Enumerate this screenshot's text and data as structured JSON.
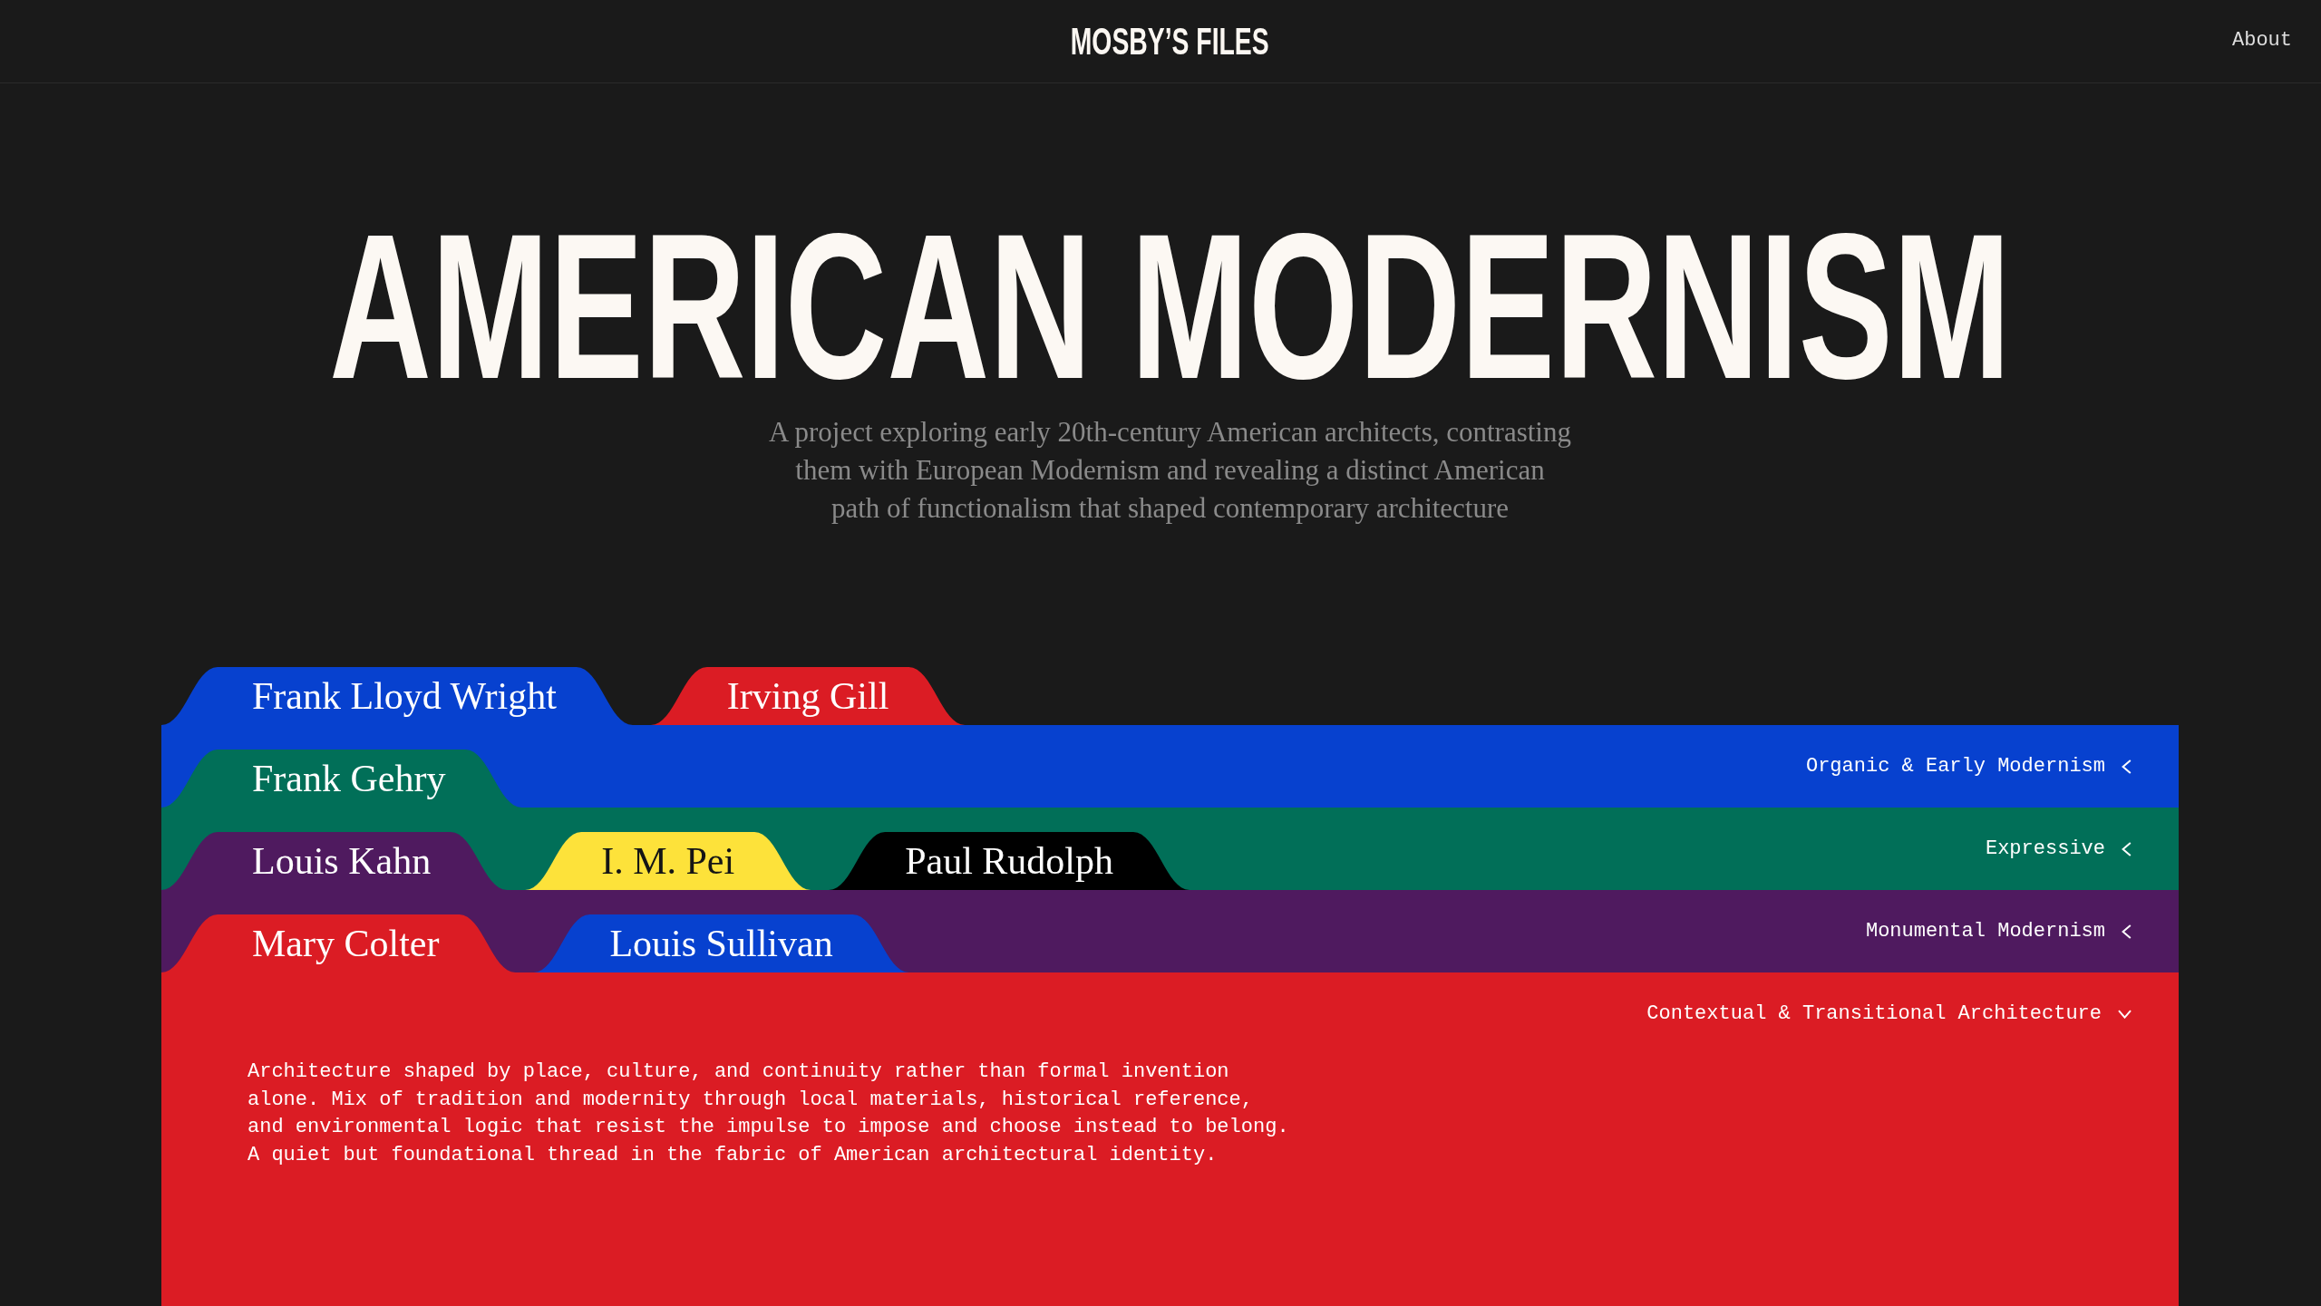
{
  "header": {
    "logo": "MOSBY’S FILES",
    "nav": [
      {
        "label": "About"
      }
    ]
  },
  "hero": {
    "title": "AMERICAN MODERNISM",
    "subtitle": "A project exploring early 20th-century American architects, contrasting them with European Modernism and revealing a distinct American path of functionalism that shaped contemporary architecture"
  },
  "categories": [
    {
      "label": "Organic & Early Modernism",
      "color": "#0741cf",
      "expanded": false,
      "architects": [
        {
          "name": "Frank Lloyd Wright",
          "color": "#0741cf"
        },
        {
          "name": "Irving Gill",
          "color": "#db1c24"
        }
      ]
    },
    {
      "label": "Expressive",
      "color": "#016f58",
      "expanded": false,
      "architects": [
        {
          "name": "Frank Gehry",
          "color": "#016f58"
        }
      ]
    },
    {
      "label": "Monumental Modernism",
      "color": "#4f1a5f",
      "expanded": false,
      "architects": [
        {
          "name": "Louis Kahn",
          "color": "#4f1a5f"
        },
        {
          "name": "I. M. Pei",
          "color": "#fde23a"
        },
        {
          "name": "Paul Rudolph",
          "color": "#000000"
        }
      ]
    },
    {
      "label": "Contextual & Transitional Architecture",
      "color": "#db1c24",
      "expanded": true,
      "description": "Architecture shaped by place, culture, and continuity rather than formal invention alone. Mix of tradition and modernity through local materials, historical reference, and environmental logic that resist the impulse to impose and choose instead to belong. A quiet but foundational thread in the fabric of American architectural identity.",
      "architects": [
        {
          "name": "Mary Colter",
          "color": "#db1c24"
        },
        {
          "name": "Louis Sullivan",
          "color": "#0741cf"
        }
      ]
    }
  ]
}
